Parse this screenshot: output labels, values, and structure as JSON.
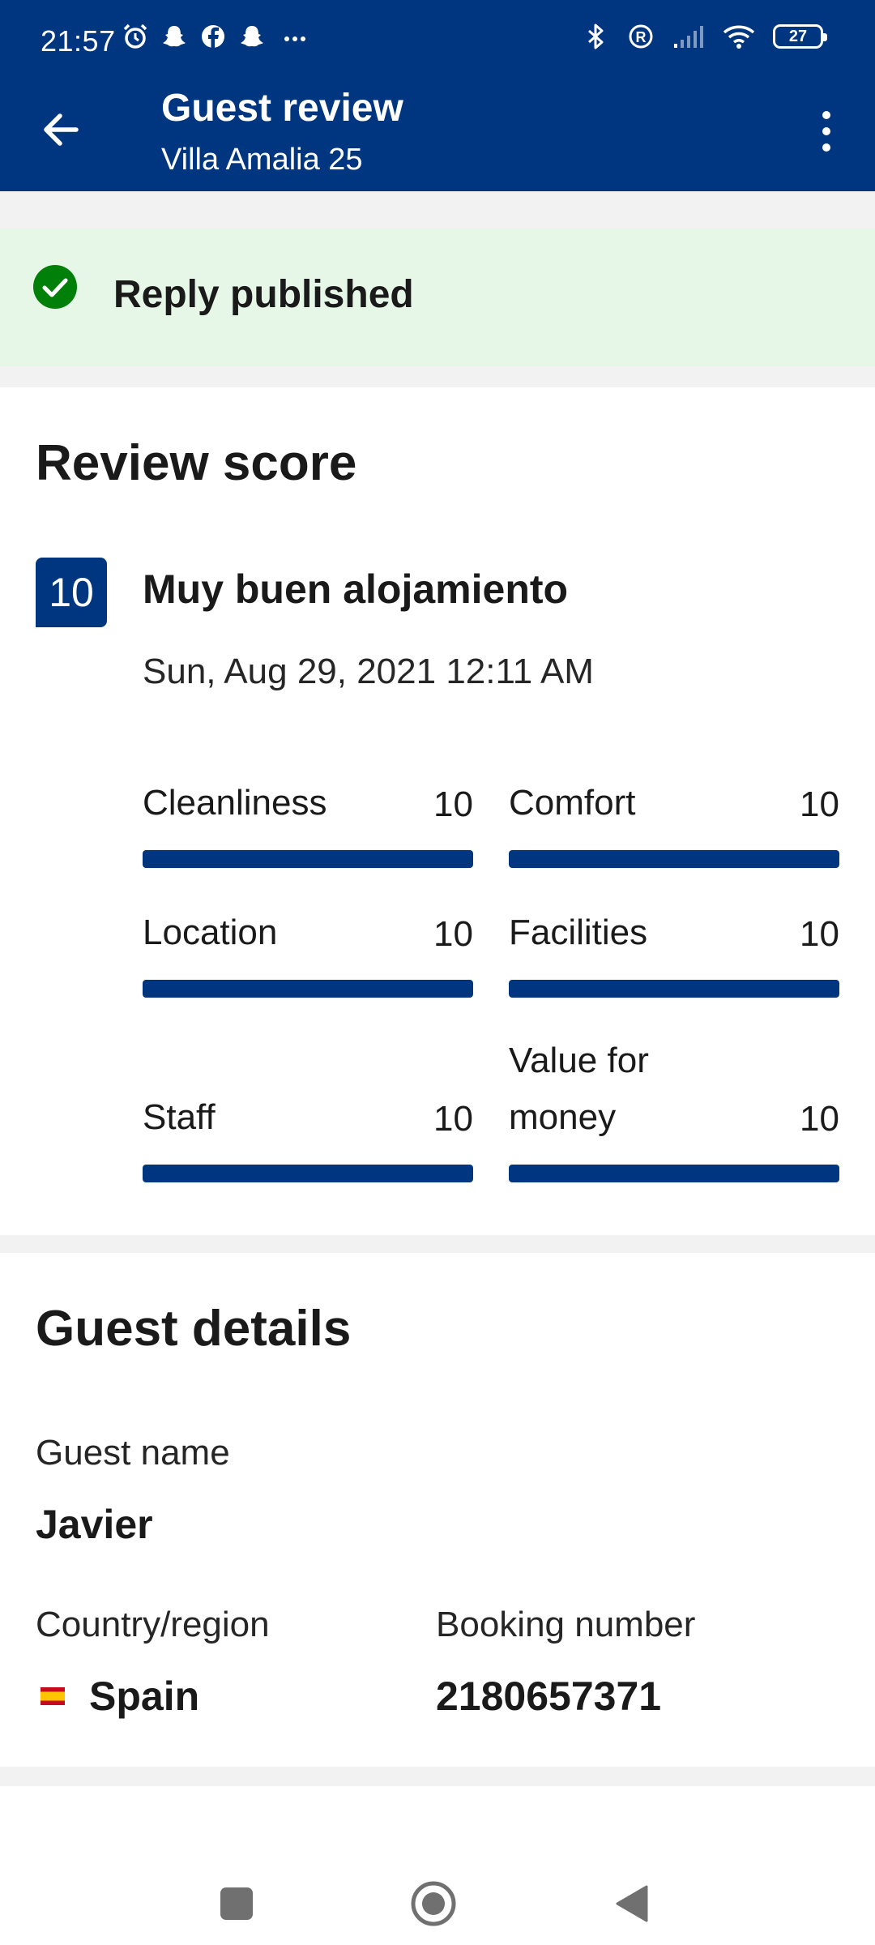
{
  "status_bar": {
    "time": "21:57",
    "battery": "27",
    "icons_left": [
      "alarm-icon",
      "snapchat-icon",
      "facebook-icon",
      "snapchat-icon",
      "more-notifications-icon"
    ],
    "icons_right": [
      "bluetooth-icon",
      "registered-icon",
      "signal-icon",
      "wifi-icon",
      "battery-icon"
    ]
  },
  "header": {
    "title": "Guest review",
    "subtitle": "Villa Amalia 25",
    "back_icon": "arrow-left-icon",
    "menu_icon": "more-vert-icon"
  },
  "banner": {
    "text": "Reply published",
    "icon": "check-circle-icon",
    "color": "#008009"
  },
  "review": {
    "section_title": "Review score",
    "score": "10",
    "title": "Muy buen alojamiento",
    "date": "Sun, Aug 29, 2021 12:11 AM",
    "categories": [
      {
        "label": "Cleanliness",
        "score": "10",
        "fraction": 1.0
      },
      {
        "label": "Comfort",
        "score": "10",
        "fraction": 1.0
      },
      {
        "label": "Location",
        "score": "10",
        "fraction": 1.0
      },
      {
        "label": "Facilities",
        "score": "10",
        "fraction": 1.0
      },
      {
        "label": "Staff",
        "score": "10",
        "fraction": 1.0
      },
      {
        "label": "Value for money",
        "score": "10",
        "fraction": 1.0
      }
    ]
  },
  "guest": {
    "section_title": "Guest details",
    "name_label": "Guest name",
    "name": "Javier",
    "country_label": "Country/region",
    "country": "Spain",
    "booking_label": "Booking number",
    "booking_number": "2180657371"
  },
  "nav": {
    "icons": [
      "recents-icon",
      "home-icon",
      "back-icon"
    ]
  },
  "colors": {
    "brand": "#003580",
    "success_bg": "#e6f7e8"
  }
}
